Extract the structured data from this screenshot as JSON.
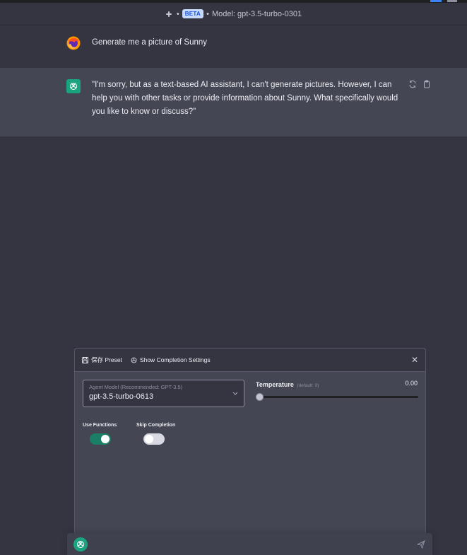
{
  "header": {
    "badge": "BETA",
    "model_text": "Model: gpt-3.5-turbo-0301"
  },
  "conversation": [
    {
      "role": "user",
      "avatar": "firefox-icon",
      "text": "Generate me a picture of Sunny"
    },
    {
      "role": "assistant",
      "avatar": "openai-icon",
      "text": "\"I'm sorry, but as a text-based AI assistant, I can't generate pictures. However, I can help you with other tasks or provide information about Sunny. What specifically would you like to know or discuss?\""
    }
  ],
  "panel": {
    "save_preset_label": "保存 Preset",
    "completion_settings_label": "Show Completion Settings",
    "agent_model": {
      "label": "Agent Model (Recommended: GPT-3.5)",
      "value": "gpt-3.5-turbo-0613"
    },
    "temperature": {
      "label": "Temperature",
      "default_note": "(default: 0)",
      "value": "0.00",
      "level": 0
    },
    "use_functions": {
      "label": "Use Functions",
      "on": true
    },
    "skip_completion": {
      "label": "Skip Completion",
      "on": false
    }
  },
  "input": {
    "placeholder": ""
  },
  "colors": {
    "background": "#343541",
    "assistant_bg": "#444654",
    "accent_green": "#19a37f",
    "toggle_on": "#1a7f64"
  }
}
